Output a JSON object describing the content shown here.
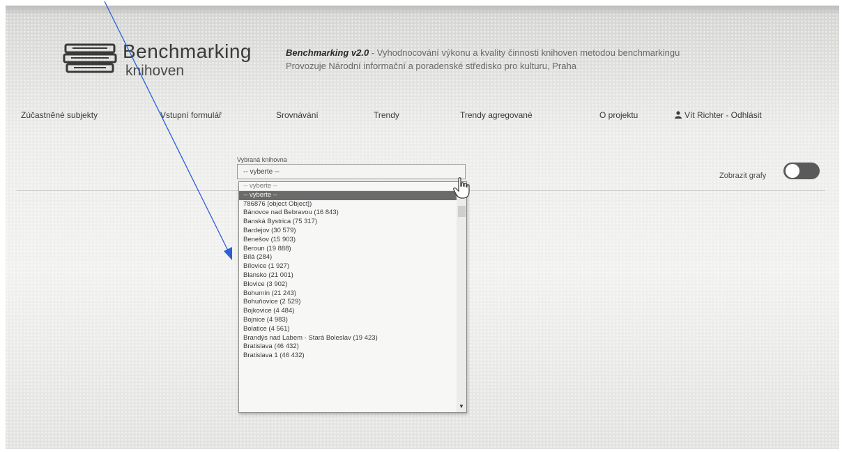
{
  "branding": {
    "title": "Benchmarking",
    "subtitle": "knihoven"
  },
  "header": {
    "app_name": "Benchmarking v2.0",
    "description": " - Vyhodnocování výkonu a kvality činnosti knihoven metodou benchmarkingu",
    "operator": "Provozuje Národní informační a poradenské středisko pro kulturu, Praha"
  },
  "nav": {
    "items": [
      "Zúčastněné subjekty",
      "Vstupní formulář",
      "Srovnávání",
      "Trendy",
      "Trendy agregované",
      "O projektu"
    ],
    "user": "Vít Richter - Odhlásit"
  },
  "filter": {
    "label": "Vybraná knihovna",
    "selected": "-- vyberte --"
  },
  "toggle": {
    "label": "Zobrazit grafy",
    "on": false
  },
  "dropdown": {
    "search": "-- vyberte --",
    "options": [
      "-- vyberte --",
      "786876 [object Object])",
      "Bánovce nad Bebravou (16 843)",
      "Banská Bystrica (75 317)",
      "Bardejov (30 579)",
      "Benešov (15 903)",
      "Beroun (19 888)",
      "Bílá (284)",
      "Bílovice (1 927)",
      "Blansko (21 001)",
      "Blovice (3 902)",
      "Bohumín (21 243)",
      "Bohuňovice (2 529)",
      "Bojkovice (4 484)",
      "Bojnice (4 983)",
      "Bolatice (4 561)",
      "Brandýs nad Labem - Stará Boleslav (19 423)",
      "Bratislava (46 432)",
      "Bratislava 1 (46 432)"
    ]
  },
  "colors": {
    "background": "#e9e9e7",
    "text": "#3a3a3a",
    "highlight": "#6b6b6b",
    "annotation": "#2b5fd6"
  },
  "icons": {
    "logo": "books-stack-icon",
    "user": "user-icon",
    "cursor": "hand-pointer-icon",
    "scroll": "scroll-down-arrow-icon"
  }
}
